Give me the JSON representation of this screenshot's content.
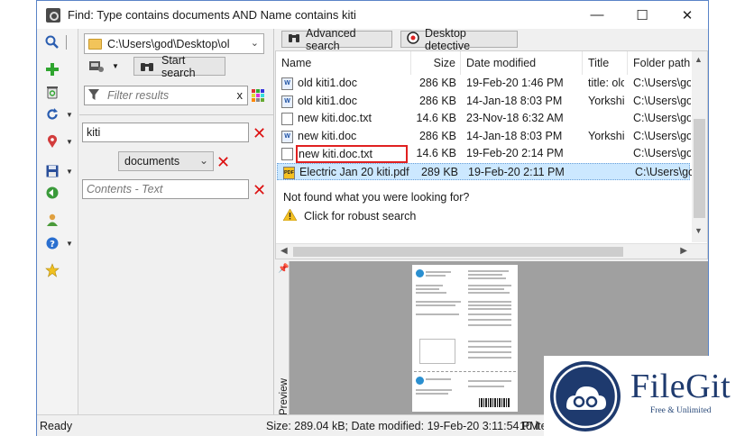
{
  "window": {
    "title": "Find: Type contains documents AND Name contains kiti",
    "minimize": "—",
    "maximize": "☐",
    "close": "✕"
  },
  "left_panel": {
    "location": "C:\\Users\\god\\Desktop\\ol",
    "start_search_label": "Start search",
    "filter_placeholder": "Filter results",
    "filter_clear": "x",
    "name_value": "kiti",
    "type_value": "documents",
    "contents_placeholder": "Contents - Text"
  },
  "top_buttons": {
    "advanced_search": "Advanced search",
    "desktop_detective": "Desktop detective"
  },
  "columns": [
    "Name",
    "Size",
    "Date modified",
    "Title",
    "Folder path"
  ],
  "rows": [
    {
      "name": "old kiti1.doc",
      "size": "286 KB",
      "date": "19-Feb-20 1:46 PM",
      "title": "title: olc",
      "path": "C:\\Users\\go",
      "icon": "word-doc-icon"
    },
    {
      "name": "old kiti1.doc",
      "size": "286 KB",
      "date": "14-Jan-18 8:03 PM",
      "title": "Yorkshi",
      "path": "C:\\Users\\go",
      "icon": "word-doc-icon"
    },
    {
      "name": "new kiti.doc.txt",
      "size": "14.6 KB",
      "date": "23-Nov-18 6:32 AM",
      "title": "",
      "path": "C:\\Users\\go",
      "icon": "text-file-icon"
    },
    {
      "name": "new kiti.doc",
      "size": "286 KB",
      "date": "14-Jan-18 8:03 PM",
      "title": "Yorkshi",
      "path": "C:\\Users\\go",
      "icon": "word-doc-icon"
    },
    {
      "name": "new kiti.doc.txt",
      "size": "14.6 KB",
      "date": "19-Feb-20 2:14 PM",
      "title": "",
      "path": "C:\\Users\\go",
      "icon": "text-file-icon"
    },
    {
      "name": "Electric Jan 20 kiti.pdf",
      "size": "289 KB",
      "date": "19-Feb-20 2:11 PM",
      "title": "",
      "path": "C:\\Users\\go",
      "icon": "pdf-icon"
    }
  ],
  "not_found": "Not found what you were looking for?",
  "robust_search": "Click for robust search",
  "preview_label": "Preview",
  "status": {
    "ready": "Ready",
    "details": "Size: 289.04 kB; Date modified: 19-Feb-20 3:11:54 PM",
    "items": "10 item(s)"
  },
  "watermark": {
    "brand": "FileGit",
    "tagline": "Free & Unlimited"
  },
  "colors": {
    "selected_row": "#cce8ff",
    "edit_border": "#e02020",
    "accent": "#1e3a6e"
  }
}
